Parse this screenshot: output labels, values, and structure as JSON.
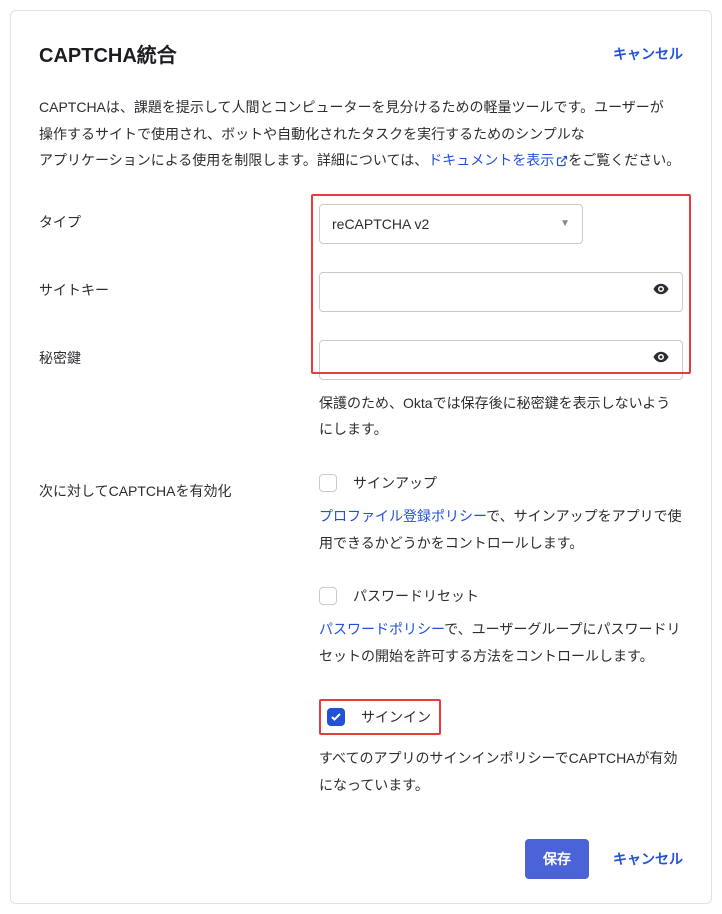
{
  "header": {
    "title": "CAPTCHA統合",
    "cancel": "キャンセル"
  },
  "description": {
    "line1": "CAPTCHAは、課題を提示して人間とコンピューターを見分けるための軽量ツールです。ユーザーが",
    "line2": "操作するサイトで使用され、ボットや自動化されたタスクを実行するためのシンプルな",
    "line3_a": "アプリケーションによる使用を制限します。詳細については、",
    "link": "ドキュメントを表示",
    "line3_b": "をご覧ください。"
  },
  "form": {
    "type_label": "タイプ",
    "type_value": "reCAPTCHA v2",
    "site_key_label": "サイトキー",
    "site_key_value": "",
    "secret_key_label": "秘密鍵",
    "secret_key_value": "",
    "secret_helper": "保護のため、Oktaでは保存後に秘密鍵を表示しないようにします。",
    "enable_label": "次に対してCAPTCHAを有効化"
  },
  "options": {
    "signup": {
      "label": "サインアップ",
      "helper_a": "",
      "link": "プロファイル登録ポリシー",
      "helper_b": "で、サインアップをアプリで使用できるかどうかをコントロールします。",
      "checked": false
    },
    "pwreset": {
      "label": "パスワードリセット",
      "helper_a": "",
      "link": "パスワードポリシー",
      "helper_b": "で、ユーザーグループにパスワードリセットの開始を許可する方法をコントロールします。",
      "checked": false
    },
    "signin": {
      "label": "サインイン",
      "helper": "すべてのアプリのサインインポリシーでCAPTCHAが有効になっています。",
      "checked": true
    }
  },
  "footer": {
    "save": "保存",
    "cancel": "キャンセル"
  }
}
